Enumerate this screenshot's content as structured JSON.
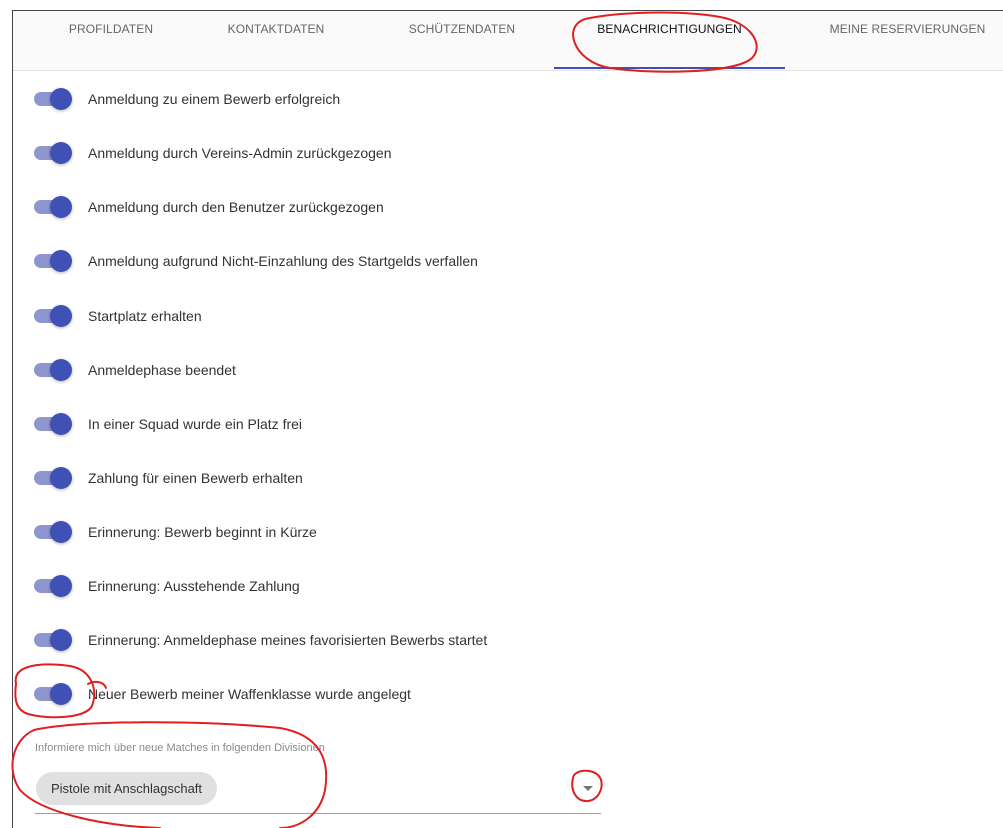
{
  "tabs": [
    {
      "label": "PROFILDATEN"
    },
    {
      "label": "KONTAKTDATEN"
    },
    {
      "label": "SCHÜTZENDATEN"
    },
    {
      "label": "BENACHRICHTIGUNGEN",
      "active": true
    },
    {
      "label": "MEINE RESERVIERUNGEN"
    }
  ],
  "notifications": [
    {
      "label": "Anmeldung zu einem Bewerb erfolgreich",
      "enabled": true
    },
    {
      "label": "Anmeldung durch Vereins-Admin zurückgezogen",
      "enabled": true
    },
    {
      "label": "Anmeldung durch den Benutzer zurückgezogen",
      "enabled": true
    },
    {
      "label": "Anmeldung aufgrund Nicht-Einzahlung des Startgelds verfallen",
      "enabled": true
    },
    {
      "label": "Startplatz erhalten",
      "enabled": true
    },
    {
      "label": "Anmeldephase beendet",
      "enabled": true
    },
    {
      "label": "In einer Squad wurde ein Platz frei",
      "enabled": true
    },
    {
      "label": "Zahlung für einen Bewerb erhalten",
      "enabled": true
    },
    {
      "label": "Erinnerung: Bewerb beginnt in Kürze",
      "enabled": true
    },
    {
      "label": "Erinnerung: Ausstehende Zahlung",
      "enabled": true
    },
    {
      "label": "Erinnerung: Anmeldephase meines favorisierten Bewerbs startet",
      "enabled": true
    },
    {
      "label": "Neuer Bewerb meiner Waffenklasse wurde angelegt",
      "enabled": true
    }
  ],
  "divisions": {
    "label": "Informiere mich über neue Matches in folgenden Divisionen",
    "selected": [
      "Pistole mit Anschlagschaft"
    ]
  },
  "colors": {
    "accent": "#3f51b5",
    "toggle_track": "#8e96cf",
    "annotation": "#e02020"
  }
}
